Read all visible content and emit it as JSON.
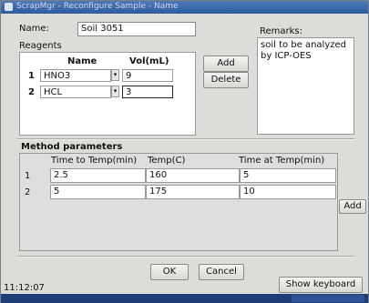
{
  "window": {
    "title": "ScrapMgr - Reconfigure Sample - Name"
  },
  "name": {
    "label": "Name:",
    "value": "Soil 3051"
  },
  "remarks": {
    "label": "Remarks:",
    "value": "soil to be analyzed by ICP-OES"
  },
  "reagents": {
    "label": "Reagents",
    "columns": [
      "Name",
      "Vol(mL)"
    ],
    "rows": [
      {
        "num": "1",
        "name": "HNO3",
        "vol": "9"
      },
      {
        "num": "2",
        "name": "HCL",
        "vol": "3"
      }
    ],
    "add_label": "Add",
    "delete_label": "Delete"
  },
  "method": {
    "label": "Method parameters",
    "columns": [
      "Time to Temp(min)",
      "Temp(C)",
      "Time at Temp(min)"
    ],
    "rows": [
      {
        "num": "1",
        "time_to_temp": "2.5",
        "temp": "160",
        "time_at_temp": "5"
      },
      {
        "num": "2",
        "time_to_temp": "5",
        "temp": "175",
        "time_at_temp": "10"
      }
    ],
    "add_label": "Add"
  },
  "footer": {
    "ok_label": "OK",
    "cancel_label": "Cancel",
    "show_keyboard_label": "Show keyboard",
    "clock": "11:12:07"
  },
  "icons": {
    "dropdown": "chevron-down-icon",
    "window": "window-icon"
  },
  "colors": {
    "titlebar": "#3a66a8",
    "statusbar": "#1f3e78",
    "window_bg": "#dcdcd8"
  }
}
